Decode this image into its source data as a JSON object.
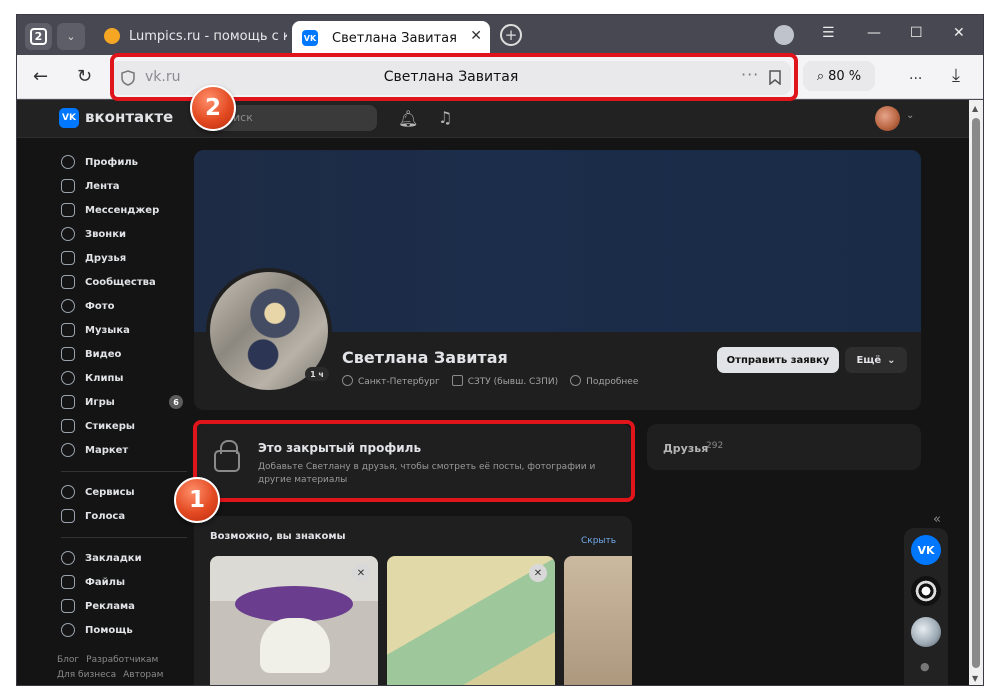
{
  "browser": {
    "tab_count": "2",
    "tabs": [
      {
        "title": "Lumpics.ru - помощь с ко"
      },
      {
        "title": "Светлана Завитая"
      }
    ],
    "address": {
      "host": "vk.ru",
      "title": "Светлана Завитая"
    },
    "zoom": "80 %",
    "more": "...",
    "new_tab": "+"
  },
  "vk": {
    "brand": "вконтакте",
    "search_placeholder": "иск",
    "nav": [
      {
        "label": "Профиль",
        "icon": "profile-icon"
      },
      {
        "label": "Лента",
        "icon": "feed-icon"
      },
      {
        "label": "Мессенджер",
        "icon": "messenger-icon"
      },
      {
        "label": "Звонки",
        "icon": "phone-icon"
      },
      {
        "label": "Друзья",
        "icon": "friends-icon"
      },
      {
        "label": "Сообщества",
        "icon": "communities-icon"
      },
      {
        "label": "Фото",
        "icon": "photo-icon"
      },
      {
        "label": "Музыка",
        "icon": "music-icon"
      },
      {
        "label": "Видео",
        "icon": "video-icon"
      },
      {
        "label": "Клипы",
        "icon": "clips-icon"
      },
      {
        "label": "Игры",
        "icon": "games-icon",
        "count": "6"
      },
      {
        "label": "Стикеры",
        "icon": "stickers-icon"
      },
      {
        "label": "Маркет",
        "icon": "market-icon"
      }
    ],
    "nav2": [
      {
        "label": "Сервисы",
        "icon": "services-icon"
      },
      {
        "label": "Голоса",
        "icon": "votes-icon"
      }
    ],
    "nav3": [
      {
        "label": "Закладки",
        "icon": "bookmarks-icon"
      },
      {
        "label": "Файлы",
        "icon": "files-icon"
      },
      {
        "label": "Реклама",
        "icon": "ads-icon"
      },
      {
        "label": "Помощь",
        "icon": "help-icon"
      }
    ],
    "footer": {
      "blog": "Блог",
      "dev": "Разработчикам",
      "business": "Для бизнеса",
      "authors": "Авторам"
    }
  },
  "profile": {
    "name": "Светлана Завитая",
    "online": "1 ч",
    "city": "Санкт-Петербург",
    "university": "СЗТУ (бывш. СЗПИ)",
    "details": "Подробнее",
    "add_button": "Отправить заявку",
    "more_button": "Ещё"
  },
  "closed_profile": {
    "title": "Это закрытый профиль",
    "description": "Добавьте Светлану в друзья, чтобы смотреть её посты, фотографии и другие материалы"
  },
  "friends": {
    "label": "Друзья",
    "count": "292"
  },
  "suggestions": {
    "title": "Возможно, вы знакомы",
    "hide": "Скрыть"
  },
  "annotations": [
    {
      "label": "1"
    },
    {
      "label": "2"
    }
  ],
  "colors": {
    "highlight": "#e0141b",
    "vk_blue": "#0077ff",
    "link": "#71aaeb"
  }
}
